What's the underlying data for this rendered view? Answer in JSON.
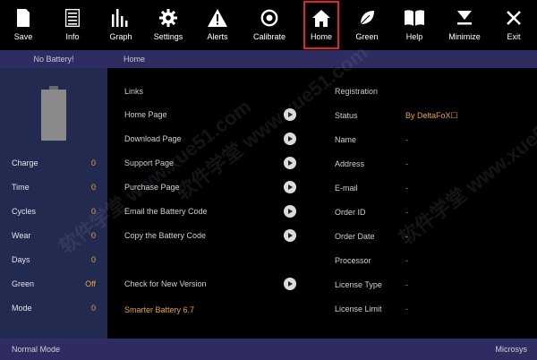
{
  "toolbar": {
    "items": [
      {
        "label": "Save",
        "icon": "save-icon"
      },
      {
        "label": "Info",
        "icon": "info-icon"
      },
      {
        "label": "Graph",
        "icon": "graph-icon"
      },
      {
        "label": "Settings",
        "icon": "settings-icon"
      },
      {
        "label": "Alerts",
        "icon": "alert-icon"
      },
      {
        "label": "Calibrate",
        "icon": "calibrate-icon"
      },
      {
        "label": "Home",
        "icon": "home-icon",
        "active": true
      },
      {
        "label": "Green",
        "icon": "leaf-icon"
      },
      {
        "label": "Help",
        "icon": "book-icon"
      },
      {
        "label": "Minimize",
        "icon": "minimize-icon"
      },
      {
        "label": "Exit",
        "icon": "close-icon"
      }
    ]
  },
  "location": {
    "battery_status": "No Battery!",
    "page": "Home"
  },
  "sidebar": {
    "stats": [
      {
        "label": "Charge",
        "value": "0"
      },
      {
        "label": "Time",
        "value": "0"
      },
      {
        "label": "Cycles",
        "value": "0"
      },
      {
        "label": "Wear",
        "value": "0"
      },
      {
        "label": "Days",
        "value": "0"
      },
      {
        "label": "Green",
        "value": "Off"
      },
      {
        "label": "Mode",
        "value": "0"
      }
    ]
  },
  "links": {
    "title": "Links",
    "items": [
      "Home Page",
      "Download Page",
      "Support Page",
      "Purchase Page",
      "Email the Battery Code",
      "Copy the Battery Code"
    ],
    "check_version": "Check for New Version",
    "version": "Smarter Battery 6.7"
  },
  "registration": {
    "title": "Registration",
    "rows": [
      {
        "label": "Status",
        "value": "By DeltaFoX☐"
      },
      {
        "label": "Name",
        "value": "-"
      },
      {
        "label": "Address",
        "value": "-"
      },
      {
        "label": "E-mail",
        "value": "-"
      },
      {
        "label": "Order ID",
        "value": "-"
      },
      {
        "label": "Order Date",
        "value": "-"
      },
      {
        "label": "Processor",
        "value": "-"
      },
      {
        "label": "License Type",
        "value": "-"
      },
      {
        "label": "License Limit",
        "value": "-"
      }
    ]
  },
  "statusbar": {
    "mode": "Normal Mode",
    "vendor": "Microsys"
  },
  "watermark": "软件学堂 www.xue51.com",
  "colors": {
    "accent": "#e8a23a",
    "bar": "#2e2c60",
    "sidebar": "#232a4f",
    "active_outline": "#e02525"
  }
}
